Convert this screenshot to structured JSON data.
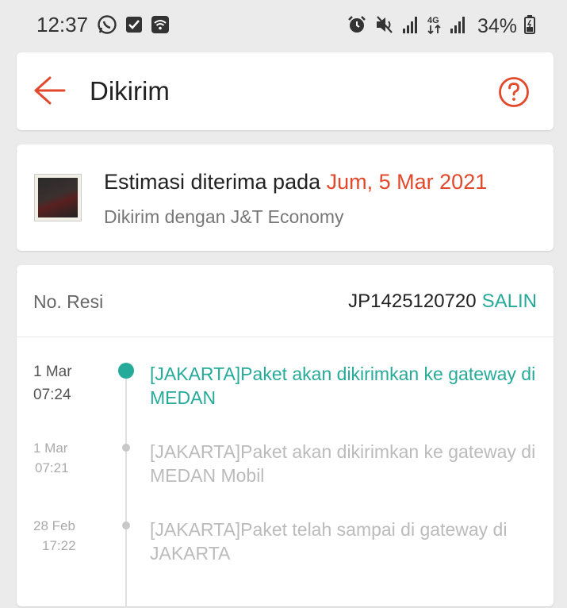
{
  "status_bar": {
    "time": "12:37",
    "battery": "34%",
    "left_icons": [
      "whatsapp-icon",
      "checkbox-icon",
      "wifi-call-icon"
    ],
    "right_icons": [
      "alarm-icon",
      "mute-icon",
      "signal-icon",
      "4g-icon",
      "signal-icon",
      "battery-icon"
    ]
  },
  "header": {
    "title": "Dikirim",
    "back_icon": "arrow-left-icon",
    "help_icon": "question-circle-icon"
  },
  "estimate": {
    "label": "Estimasi diterima pada",
    "date": "Jum, 5 Mar 2021",
    "courier": "Dikirim dengan J&T Economy"
  },
  "tracking": {
    "resi_label": "No. Resi",
    "resi_number": "JP1425120720",
    "copy_label": "SALIN",
    "events": [
      {
        "date": "1 Mar",
        "time": "07:24",
        "text": "[JAKARTA]Paket akan dikirimkan ke gateway di MEDAN",
        "active": true
      },
      {
        "date": "1 Mar",
        "time": "07:21",
        "text": "[JAKARTA]Paket akan dikirimkan ke gateway di MEDAN Mobil",
        "active": false
      },
      {
        "date": "28 Feb",
        "time": "17:22",
        "text": "[JAKARTA]Paket telah sampai di gateway di JAKARTA",
        "active": false
      }
    ]
  },
  "colors": {
    "accent_orange": "#e2492b",
    "accent_teal": "#26aa99",
    "background": "#ebebeb"
  }
}
